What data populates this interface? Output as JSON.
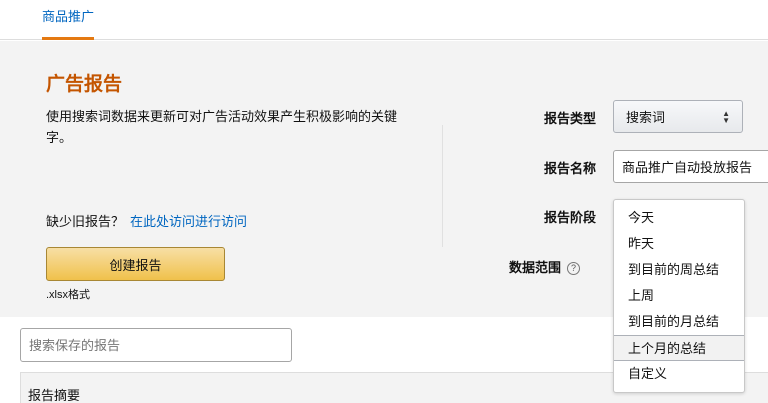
{
  "nav": {
    "active_tab": "商品推广"
  },
  "panel": {
    "title": "广告报告",
    "description": "使用搜索词数据来更新可对广告活动效果产生积极影响的关键字。",
    "missing_text": "缺少旧报告？",
    "missing_link": "在此处访问进行访问",
    "create_button": "创建报告",
    "format_note": ".xlsx格式"
  },
  "form": {
    "type_label": "报告类型",
    "type_value": "搜索词",
    "name_label": "报告名称",
    "name_value": "商品推广自动投放报告",
    "period_label": "报告阶段",
    "range_label": "数据范围",
    "help_icon": "?"
  },
  "period_dropdown": {
    "options": [
      "今天",
      "昨天",
      "到目前的周总结",
      "上周",
      "到目前的月总结",
      "上个月的总结",
      "自定义"
    ],
    "selected_index": 5
  },
  "reports": {
    "search_placeholder": "搜索保存的报告",
    "summary_header": "报告摘要"
  },
  "colors": {
    "accent": "#e47911",
    "title": "#c45500",
    "link": "#0066c0",
    "button": "#f0c14b"
  }
}
